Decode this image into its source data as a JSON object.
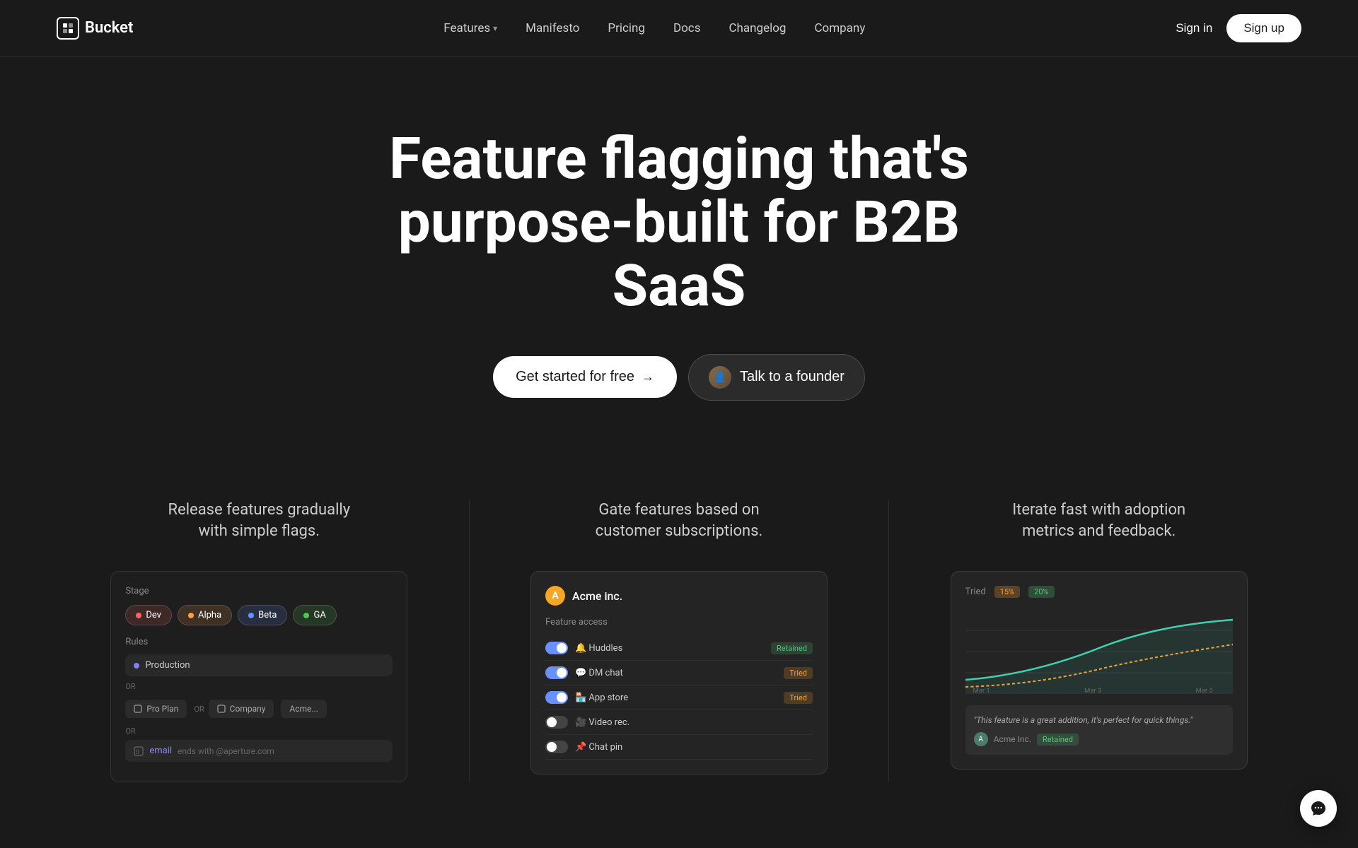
{
  "brand": {
    "name": "Bucket",
    "logo_alt": "Bucket logo"
  },
  "navbar": {
    "features_label": "Features",
    "manifesto_label": "Manifesto",
    "pricing_label": "Pricing",
    "docs_label": "Docs",
    "changelog_label": "Changelog",
    "company_label": "Company",
    "signin_label": "Sign in",
    "signup_label": "Sign up"
  },
  "hero": {
    "title_line1": "Feature flagging that's",
    "title_line2": "purpose-built for B2B SaaS",
    "cta_primary": "Get started for free",
    "cta_secondary": "Talk to a founder"
  },
  "features": [
    {
      "title": "Release features gradually\nwith simple flags.",
      "card_type": "flags"
    },
    {
      "title": "Gate features based on\ncustomer subscriptions.",
      "card_type": "subscriptions"
    },
    {
      "title": "Iterate fast with adoption\nmetrics and feedback.",
      "card_type": "metrics"
    }
  ],
  "mock_card_1": {
    "stage_label": "Stage",
    "tabs": [
      "Dev",
      "Alpha",
      "Beta",
      "GA"
    ],
    "rules_label": "Rules",
    "production_label": "Production",
    "or_label": "OR",
    "chips": [
      "Pro Plan",
      "Company",
      "Acme..."
    ],
    "email_label": "email",
    "email_rule": "ends with @aperture.com"
  },
  "mock_card_2": {
    "company_name": "Acme inc.",
    "feature_access_label": "Feature access",
    "features": [
      {
        "name": "Huddles",
        "enabled": true,
        "badge": "Retained"
      },
      {
        "name": "DM chat",
        "enabled": true,
        "badge": "Tried"
      },
      {
        "name": "App store",
        "enabled": true,
        "badge": "Tried"
      },
      {
        "name": "Video rec.",
        "enabled": false,
        "badge": ""
      },
      {
        "name": "Chat pin",
        "enabled": false,
        "badge": ""
      }
    ]
  },
  "mock_card_3": {
    "tried_label": "Tried",
    "percent_15": "15%",
    "percent_20": "20%",
    "date_labels": [
      "Mar 1",
      "Mar 3",
      "Mar 5"
    ],
    "testimonial_text": "\"This feature is a great addition, it's perfect for quick things.\"",
    "testimonial_company": "Acme Inc.",
    "testimonial_badge": "Retained"
  },
  "chat": {
    "icon_label": "chat-support-icon"
  }
}
